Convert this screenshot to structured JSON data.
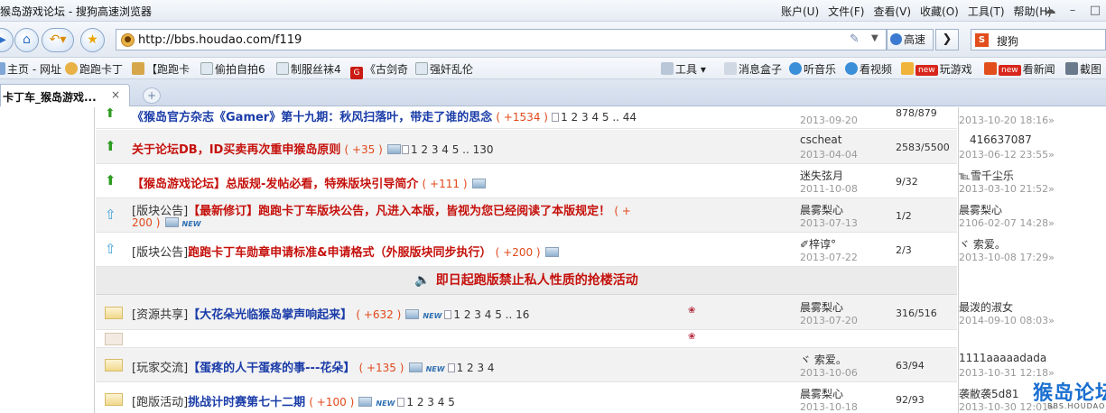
{
  "window": {
    "title": "猴岛游戏论坛 - 搜狗高速浏览器",
    "menus": [
      "账户(U)",
      "文件(F)",
      "查看(V)",
      "收藏(O)",
      "工具(T)",
      "帮助(H)"
    ]
  },
  "navbar": {
    "url": "http://bbs.houdao.com/f119",
    "mode_label": "高速",
    "search_text": "搜狗"
  },
  "bookmarks": {
    "left": [
      "主页 - 网址",
      "跑跑卡丁",
      "【跑跑卡",
      "偷拍自拍6",
      "制服丝袜4",
      "《古剑奇",
      "强奸乱伦"
    ],
    "right": [
      "工具",
      "消息盒子",
      "听音乐",
      "看视频",
      "玩游戏",
      "看新闻",
      "截图"
    ],
    "new_badge": "new"
  },
  "tabs": [
    {
      "label": "卡丁车_猴岛游戏...",
      "close": "×"
    }
  ],
  "new_tab_symbol": "+",
  "threads": [
    {
      "title": "《猴岛官方杂志《Gamer》第十九期：秋风扫落叶，带走了谁的思念",
      "score": "( +1534 )",
      "pages": "1 2 3 4 5 .. 44",
      "author": "",
      "date": "2013-09-20",
      "replies": "878/879",
      "last_user": "",
      "last_date": "2013-10-20 18:16»"
    },
    {
      "title": "关于论坛DB，ID买卖再次重申猴岛原则",
      "score": "( +35 )",
      "pages": "1 2 3 4 5 .. 130",
      "author": "cscheat",
      "date": "2013-04-04",
      "replies": "2583/5500",
      "last_user": "416637087",
      "last_date": "2013-06-12 23:55»"
    },
    {
      "title": "【猴岛游戏论坛】总版规-发帖必看，特殊版块引导简介",
      "score": "( +111 )",
      "pages": "",
      "author": "迷失弦月",
      "date": "2011-10-08",
      "replies": "9/32",
      "last_user": "℡雪千尘乐",
      "last_date": "2013-03-10 21:52»"
    },
    {
      "category": "[版块公告]",
      "title": "【最新修订】跑跑卡丁车版块公告，凡进入本版，皆视为您已经阅读了本版规定！",
      "score_a": "( +",
      "score_b": "200 )",
      "author": "晨雾梨心",
      "date": "2013-07-13",
      "replies": "1/2",
      "last_user": "晨雾梨心",
      "last_date": "2106-02-07 14:28»"
    },
    {
      "category": "[版块公告]",
      "title": "跑跑卡丁车勋章申请标准&申请格式（外服版块同步执行）",
      "score": "( +200 )",
      "author": "✐梓谆°",
      "date": "2013-07-22",
      "replies": "2/3",
      "last_user": "ヾ 索爱。",
      "last_date": "2013-10-08 17:29»"
    }
  ],
  "notice": "即日起跑版禁止私人性质的抢楼活动",
  "posts": [
    {
      "category": "[资源共享]",
      "title": "【大花朵光临猴岛掌声响起来】",
      "score": "( +632 )",
      "pages": "1 2 3 4 5 .. 16",
      "author": "晨雾梨心",
      "date": "2013-07-20",
      "replies": "316/516",
      "last_user": "最泼的淑女",
      "last_date": "2014-09-10 08:03»"
    },
    {
      "category": "",
      "title": "",
      "score": "",
      "pages": "",
      "author": "",
      "date": "",
      "replies": "",
      "last_user": "",
      "last_date": ""
    },
    {
      "category": "[玩家交流]",
      "title": "【蛋疼的人干蛋疼的事---花朵】",
      "score": "( +135 )",
      "pages": "1 2 3 4",
      "author": "ヾ 索爱。",
      "date": "2013-10-06",
      "replies": "63/94",
      "last_user": "1111aaaaadada",
      "last_date": "2013-10-31 12:18»"
    },
    {
      "category": "[跑版活动]",
      "title": "挑战计时赛第七十二期",
      "score": "( +100 )",
      "pages": "1 2 3 4 5",
      "author": "晨雾梨心",
      "date": "2013-10-18",
      "replies": "92/93",
      "last_user": "袭敝袭5d81",
      "last_date": "2013-10-30 12:01»"
    }
  ],
  "new_tag": "NEW",
  "watermark": {
    "logo": "猴岛论坛",
    "domain": "BBS.HOUDAO.COM"
  },
  "colors": {
    "red_title": "#c5110c",
    "blue_title": "#1a3ca8",
    "score": "#e0491b",
    "accent": "#2d6fc9"
  }
}
